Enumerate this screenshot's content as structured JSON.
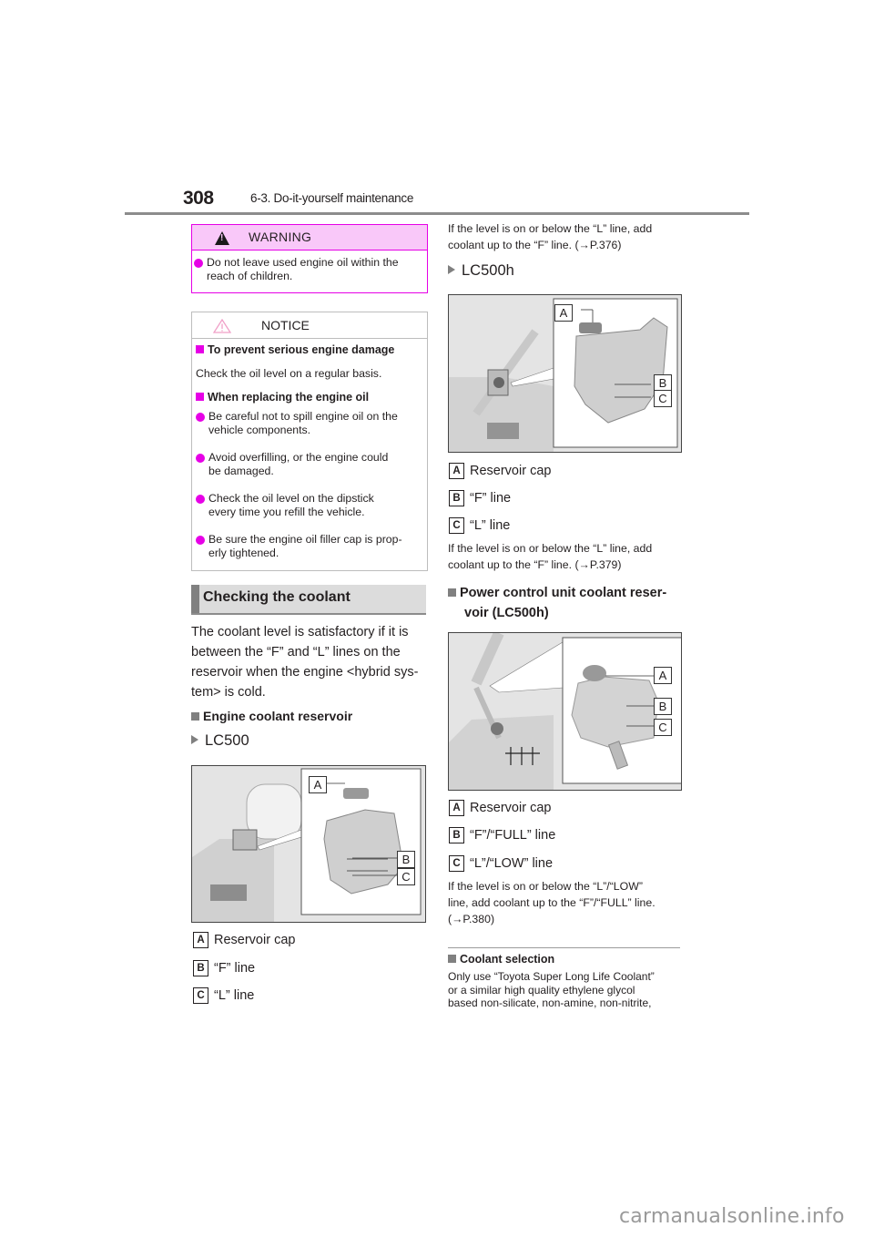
{
  "header": {
    "page_number": "308",
    "section": "6-3. Do-it-yourself maintenance"
  },
  "warning": {
    "icon": "warning-triangle-icon",
    "title": "WARNING",
    "items": [
      "Do not leave used engine oil within the reach of children."
    ]
  },
  "notice": {
    "icon": "notice-triangle-icon",
    "title": "NOTICE",
    "subheads": [
      "To prevent serious engine damage",
      "When replacing the engine oil"
    ],
    "text": "Check the oil level on a regular basis.",
    "items": [
      "Be careful not to spill engine oil on the vehicle components.",
      "Avoid overfilling, or the engine could be damaged.",
      "Check the oil level on the dipstick every time you refill the vehicle.",
      "Be sure the engine oil filler cap is properly tightened."
    ],
    "items_display": [
      [
        "Be careful not to spill engine oil on the",
        "vehicle components."
      ],
      [
        "Avoid overfilling, or the engine could",
        "be damaged."
      ],
      [
        "Check the oil level on the dipstick",
        "every time you refill the vehicle."
      ],
      [
        "Be sure the engine oil filler cap is prop-",
        "erly tightened."
      ]
    ]
  },
  "section": {
    "title": "Checking the coolant",
    "intro_lines": [
      "The coolant level is satisfactory if it is",
      "between the “F” and “L” lines on the",
      "reservoir when the engine <hybrid sys-",
      "tem> is cold."
    ],
    "engine_reservoir_heading": "Engine coolant reservoir"
  },
  "lc500": {
    "model": "LC500",
    "figure": {
      "labels": [
        "A",
        "B",
        "C"
      ]
    },
    "legend": [
      {
        "key": "A",
        "text": "Reservoir cap"
      },
      {
        "key": "B",
        "text": "“F” line"
      },
      {
        "key": "C",
        "text": "“L” line"
      }
    ],
    "note_lines": [
      "If the level is on or below the “L” line, add",
      "coolant up to the “F” line. (→P.376)"
    ]
  },
  "lc500h": {
    "model": "LC500h",
    "figure": {
      "labels": [
        "A",
        "B",
        "C"
      ]
    },
    "legend": [
      {
        "key": "A",
        "text": "Reservoir cap"
      },
      {
        "key": "B",
        "text": "“F” line"
      },
      {
        "key": "C",
        "text": "“L” line"
      }
    ],
    "note_lines": [
      "If the level is on or below the “L” line, add",
      "coolant up to the “F” line. (→P.379)"
    ]
  },
  "pcu": {
    "heading_lines": [
      "Power control unit coolant reser-",
      "voir (LC500h)"
    ],
    "figure": {
      "labels": [
        "A",
        "B",
        "C"
      ]
    },
    "legend": [
      {
        "key": "A",
        "text": "Reservoir cap"
      },
      {
        "key": "B",
        "text": "“F”/“FULL” line"
      },
      {
        "key": "C",
        "text": "“L”/“LOW” line"
      }
    ],
    "note_lines": [
      "If the level is on or below the “L”/“LOW”",
      "line, add coolant up to the “F”/“FULL” line.",
      "(→P.380)"
    ]
  },
  "coolant_selection": {
    "heading": "Coolant selection",
    "lines": [
      "Only use “Toyota Super Long Life Coolant”",
      "or a similar high quality ethylene glycol",
      "based non-silicate, non-amine, non-nitrite,"
    ]
  },
  "watermark": "carmanualsonline.info"
}
